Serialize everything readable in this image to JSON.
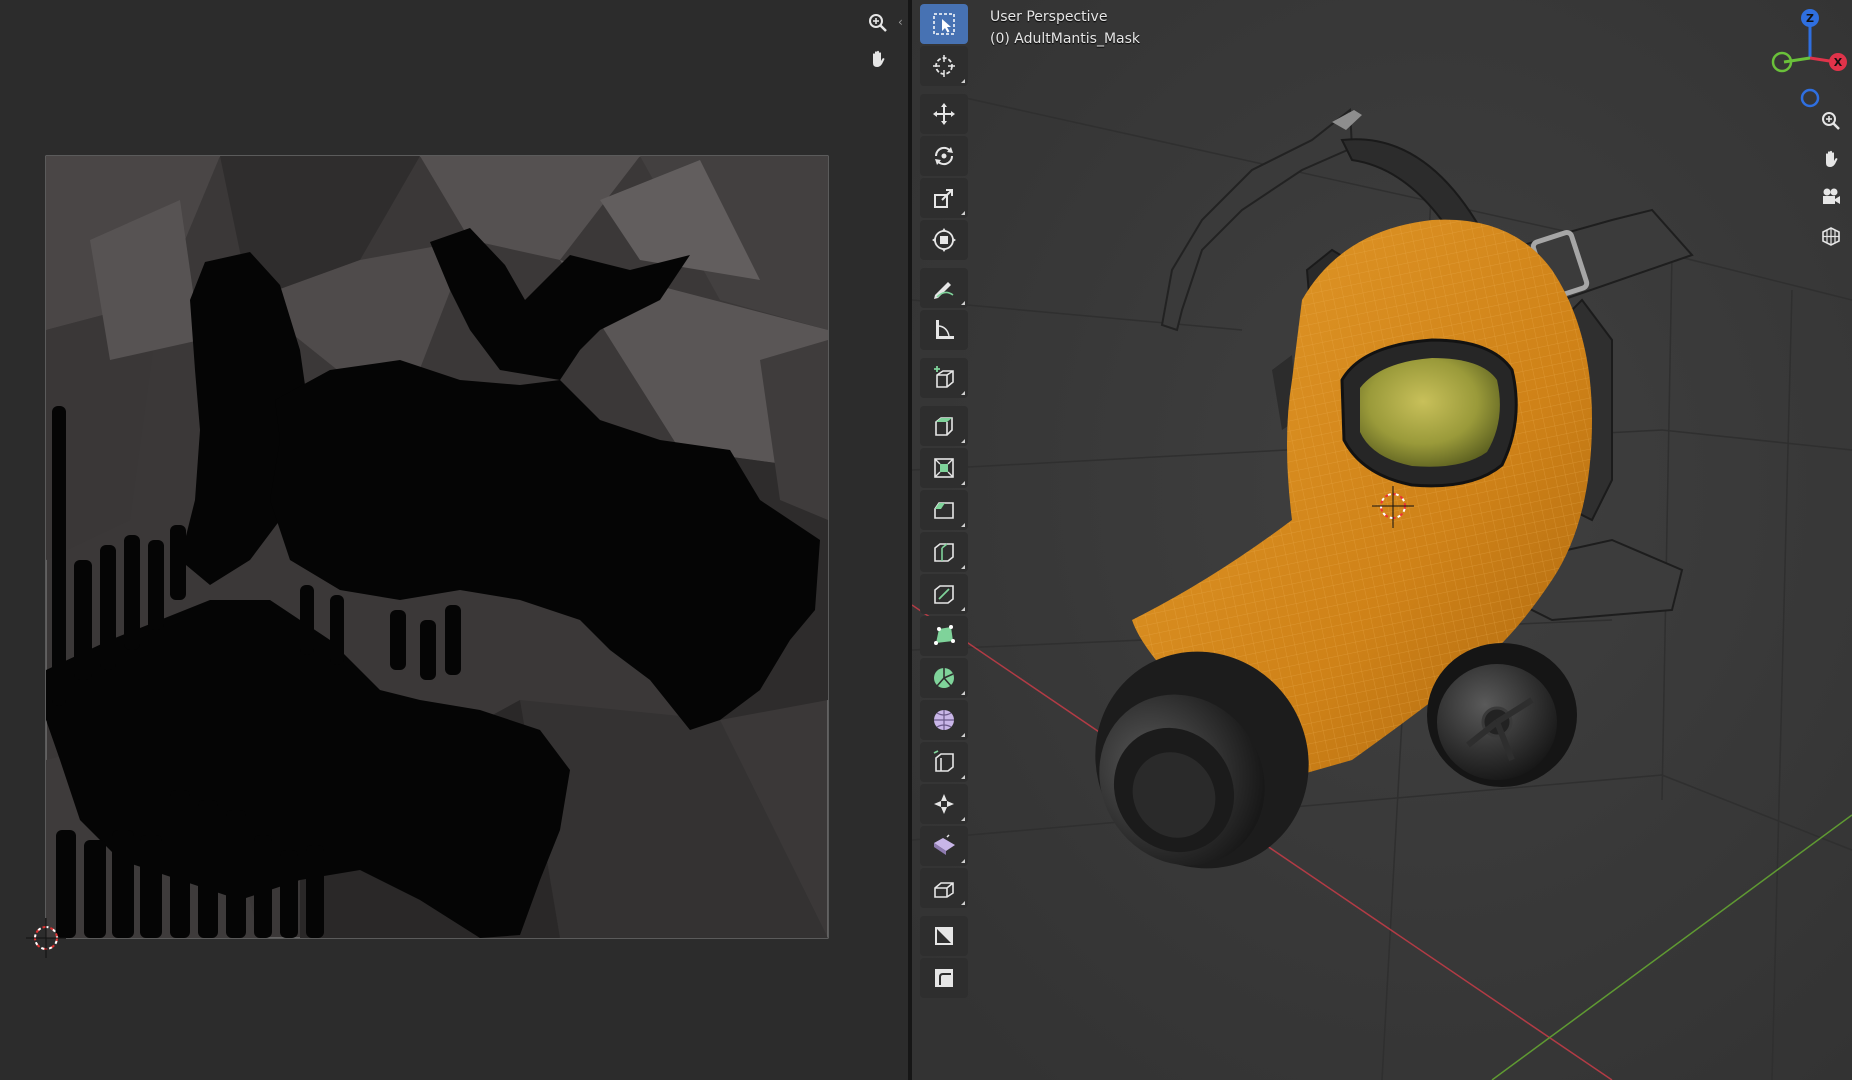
{
  "uv_editor": {
    "nav_icons": [
      "zoom-icon",
      "pan-hand-icon"
    ],
    "collapse_arrow": "‹"
  },
  "viewport": {
    "header_view": "User Perspective",
    "header_object": "(0) AdultMantis_Mask",
    "tools": [
      {
        "name": "select-box-tool",
        "icon": "select-box-icon",
        "active": true
      },
      {
        "name": "cursor-tool",
        "icon": "cursor-icon"
      },
      {
        "name": "move-tool",
        "icon": "move-icon"
      },
      {
        "name": "rotate-tool",
        "icon": "rotate-icon"
      },
      {
        "name": "scale-tool",
        "icon": "scale-icon"
      },
      {
        "name": "transform-tool",
        "icon": "transform-icon"
      },
      {
        "name": "annotate-tool",
        "icon": "annotate-icon"
      },
      {
        "name": "measure-tool",
        "icon": "measure-icon"
      },
      {
        "name": "add-cube-tool",
        "icon": "add-cube-icon"
      },
      {
        "name": "extrude-region-tool",
        "icon": "extrude-icon"
      },
      {
        "name": "inset-faces-tool",
        "icon": "inset-icon"
      },
      {
        "name": "bevel-tool",
        "icon": "bevel-icon"
      },
      {
        "name": "loop-cut-tool",
        "icon": "loop-cut-icon"
      },
      {
        "name": "knife-tool",
        "icon": "knife-icon"
      },
      {
        "name": "poly-build-tool",
        "icon": "poly-build-icon"
      },
      {
        "name": "spin-tool",
        "icon": "spin-icon"
      },
      {
        "name": "smooth-tool",
        "icon": "smooth-icon"
      },
      {
        "name": "edge-slide-tool",
        "icon": "edge-slide-icon"
      },
      {
        "name": "shrink-fatten-tool",
        "icon": "shrink-fatten-icon"
      },
      {
        "name": "shear-tool",
        "icon": "shear-icon"
      },
      {
        "name": "rip-region-tool",
        "icon": "rip-icon"
      },
      {
        "name": "uv-sync-tool",
        "icon": "uv-sync-icon"
      },
      {
        "name": "uv-edge-tool",
        "icon": "uv-edge-icon"
      }
    ],
    "gizmo": {
      "z": "Z",
      "x": "X",
      "y": "",
      "colors": {
        "z": "#2f6fe0",
        "x": "#e0334a",
        "y": "#6ac13a"
      }
    },
    "nav_icons": [
      "zoom-icon",
      "pan-hand-icon",
      "camera-icon",
      "grid-icon"
    ]
  },
  "colors": {
    "accent": "#4772b3",
    "mask_orange": "#d68a1f",
    "x_axis": "#b23b45",
    "y_axis": "#5f9a32"
  }
}
